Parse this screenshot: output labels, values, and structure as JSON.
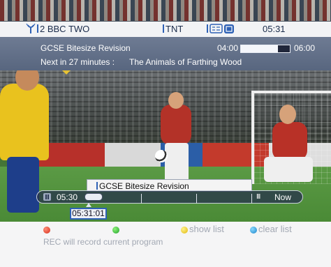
{
  "channel": {
    "name": "2 BBC TWO",
    "network": "TNT",
    "clock": "05:31"
  },
  "epg": {
    "current_title": "GCSE Bitesize Revision",
    "start_time": "04:00",
    "end_time": "06:00",
    "progress_fraction": 0.76,
    "next_label": "Next in 27 minutes :",
    "next_title": "The Animals of Farthing Wood"
  },
  "timeshift": {
    "tooltip_title": "GCSE Bitesize Revision",
    "buffer_start": "05:30",
    "current_position": "05:31:01",
    "live_label": "Now",
    "live_marker": "III"
  },
  "keys": {
    "yellow_label": "show list",
    "blue_label": "clear list",
    "help_text": "REC will record current program"
  },
  "colors": {
    "accent_blue": "#2e61b5",
    "info_panel": "#5f6d86",
    "red_key": "#d52a16",
    "green_key": "#1ea12a",
    "yellow_key": "#e0b80c",
    "blue_key": "#1a84c9"
  },
  "icons": {
    "antenna": "antenna-signal-icon",
    "subtitles": "subtitles-icon",
    "teletext": "teletext-icon"
  }
}
